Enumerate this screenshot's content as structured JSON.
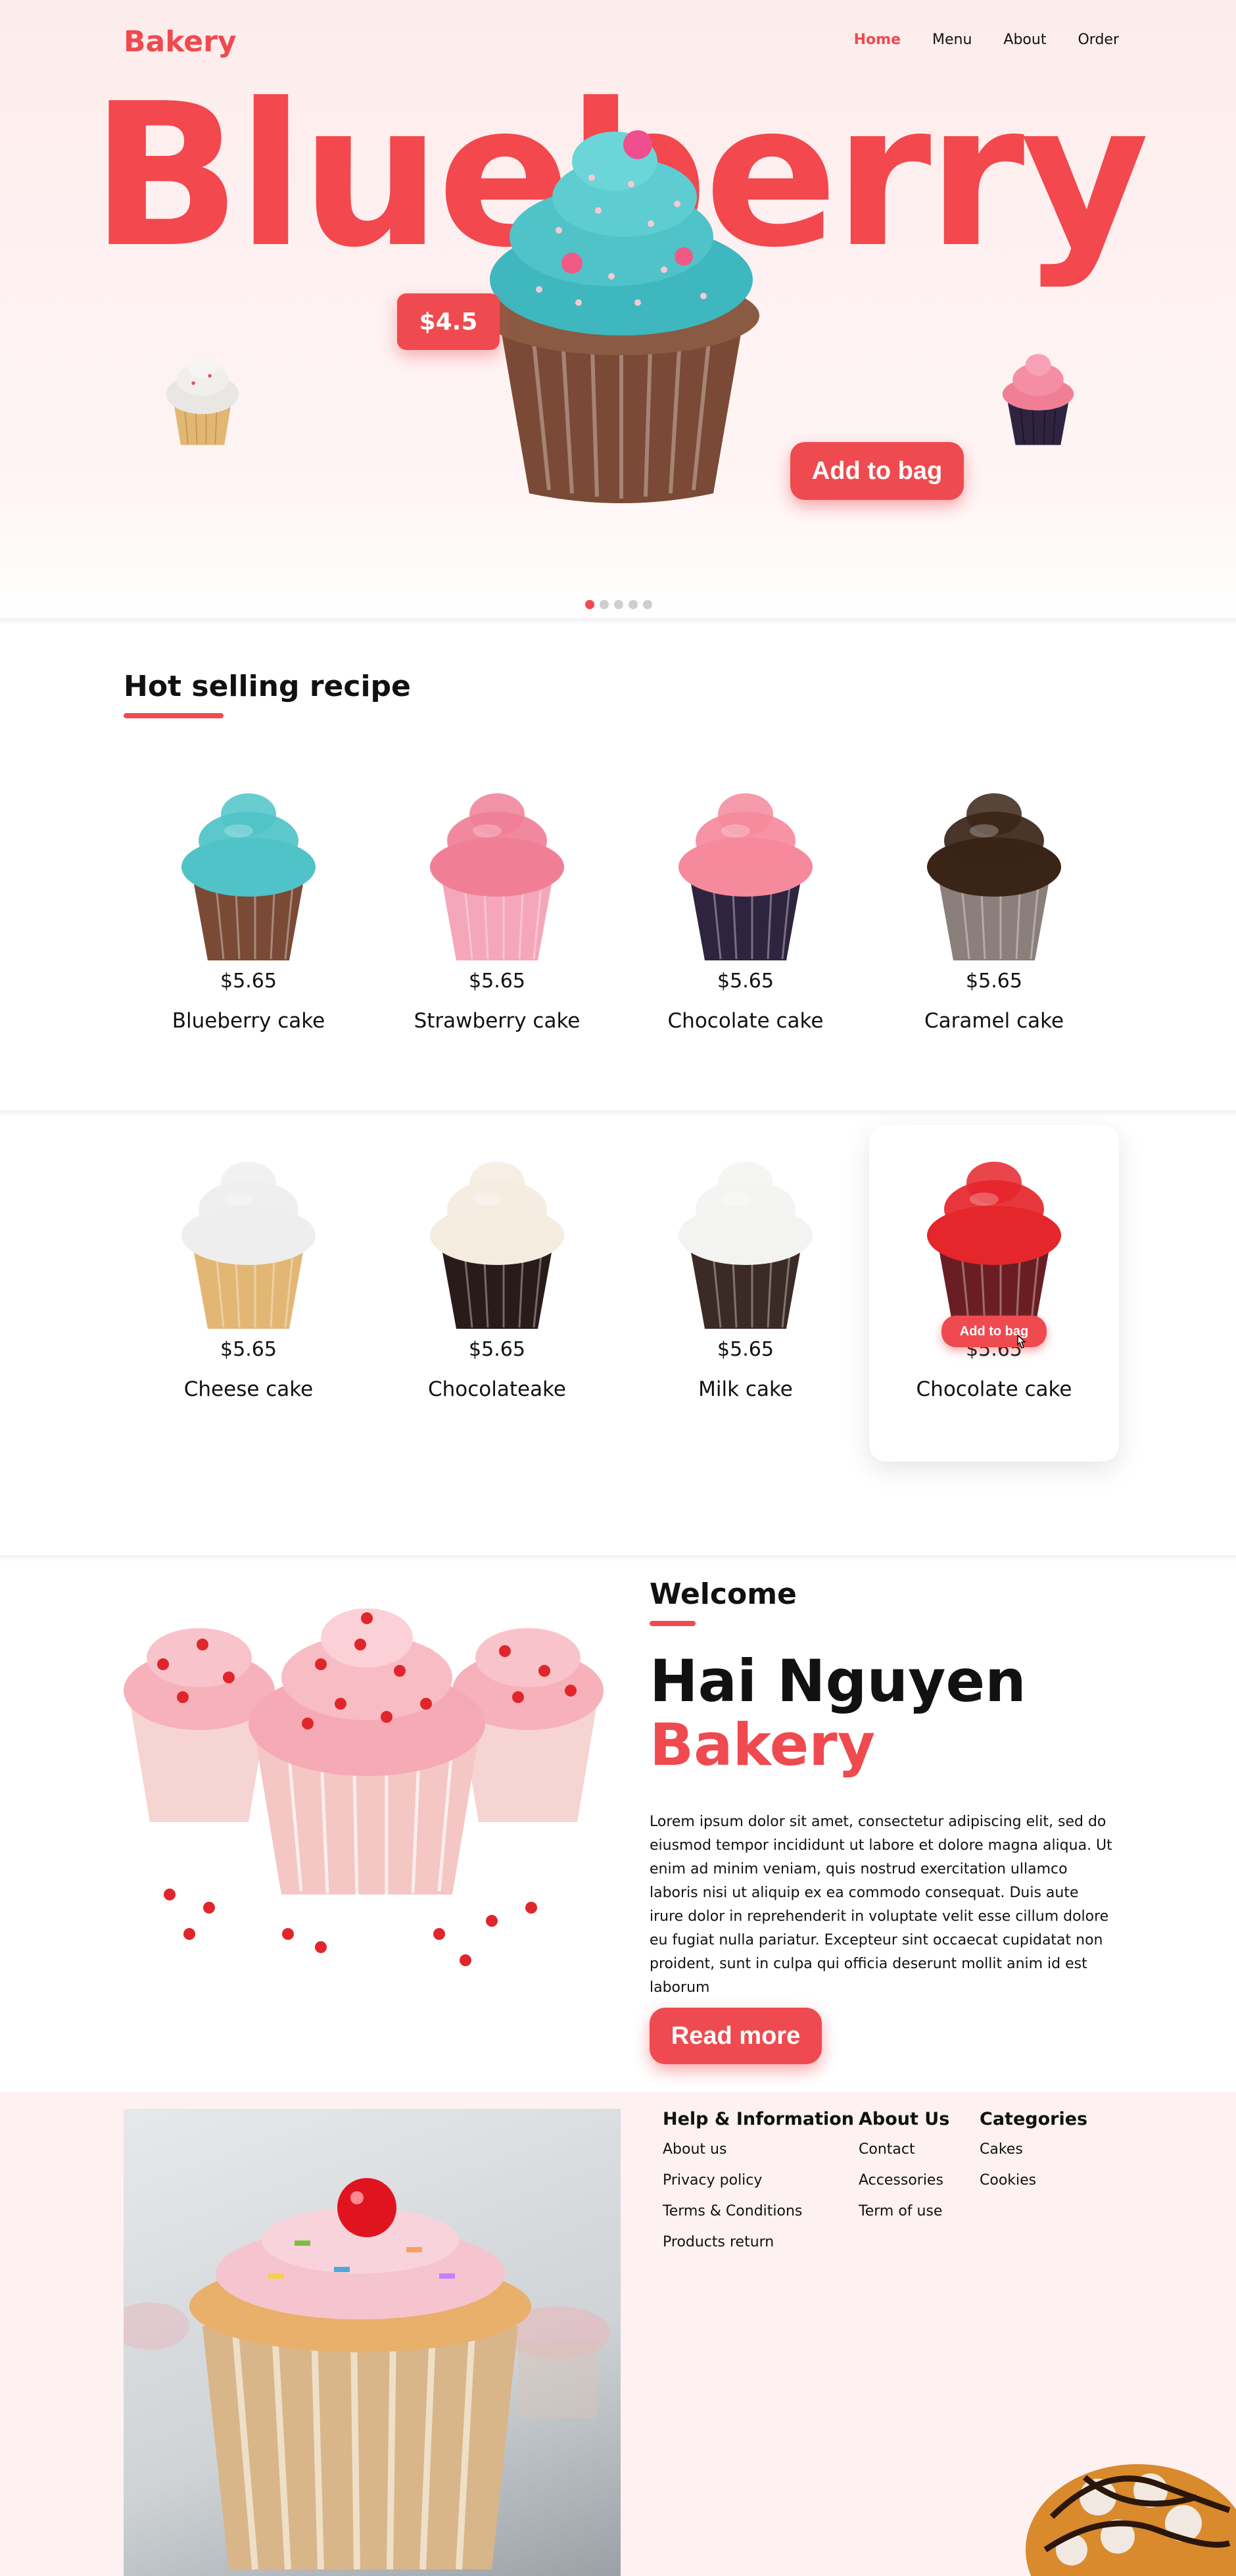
{
  "header": {
    "logo": "Bakery",
    "nav": [
      "Home",
      "Menu",
      "About",
      "Order"
    ],
    "active_nav": "Home"
  },
  "hero": {
    "title": "Blueberry",
    "price": "$4.5",
    "add_to_bag": "Add to bag",
    "slides": 5,
    "active_slide": 1
  },
  "hot_selling": {
    "title": "Hot selling recipe",
    "row1": [
      {
        "price": "$5.65",
        "name": "Blueberry cake",
        "frosting": "#4fc3c8",
        "wrapper": "#7a4a36"
      },
      {
        "price": "$5.65",
        "name": "Strawberry cake",
        "frosting": "#f07f96",
        "wrapper": "#f5a7b9"
      },
      {
        "price": "$5.65",
        "name": "Chocolate cake",
        "frosting": "#f58a9c",
        "wrapper": "#2e2440"
      },
      {
        "price": "$5.65",
        "name": "Caramel cake",
        "frosting": "#3a2418",
        "wrapper": "#8a7f7a"
      }
    ],
    "row2": [
      {
        "price": "$5.65",
        "name": "Cheese cake",
        "frosting": "#efeeee",
        "wrapper": "#e2b774"
      },
      {
        "price": "$5.65",
        "name": "Chocolateake",
        "frosting": "#f4ecdf",
        "wrapper": "#2a1b1b"
      },
      {
        "price": "$5.65",
        "name": "Milk cake",
        "frosting": "#f3f3f2",
        "wrapper": "#3b2a26"
      },
      {
        "price": "$5.65",
        "name": "Chocolate cake",
        "frosting": "#e5262b",
        "wrapper": "#6a1e24",
        "add_to_bag": "Add to bag"
      }
    ]
  },
  "welcome": {
    "heading": "Welcome",
    "name_line1": "Hai Nguyen",
    "name_line2": "Bakery",
    "body": "Lorem ipsum dolor sit amet, consectetur adipiscing elit, sed do eiusmod tempor incididunt ut labore et dolore magna aliqua. Ut enim ad minim veniam, quis nostrud exercitation ullamco laboris nisi ut aliquip ex ea commodo consequat. Duis aute irure dolor in reprehenderit in voluptate velit esse cillum dolore eu fugiat nulla pariatur. Excepteur sint occaecat cupidatat non proident, sunt in culpa qui officia deserunt mollit anim id est laborum",
    "read_more": "Read more"
  },
  "footer": {
    "help": {
      "title": "Help & Information",
      "links": [
        "About us",
        "Privacy policy",
        "Terms & Conditions",
        "Products return"
      ]
    },
    "about": {
      "title": "About Us",
      "links": [
        "Contact",
        "Accessories",
        "Term of use"
      ]
    },
    "categories": {
      "title": "Categories",
      "links": [
        "Cakes",
        "Cookies"
      ]
    }
  },
  "colors": {
    "accent": "#ef4a4f",
    "hero_bg": "#fdecec"
  }
}
